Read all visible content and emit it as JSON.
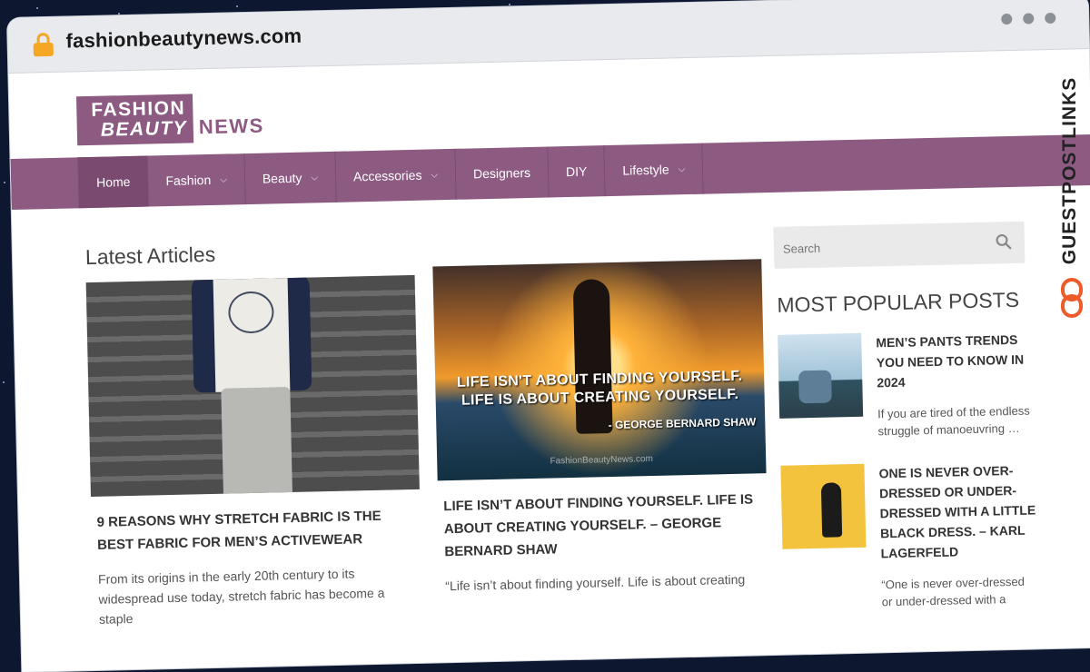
{
  "browser": {
    "url": "fashionbeautynews.com"
  },
  "logo": {
    "line1": "FASHION",
    "line2": "BEAUTY",
    "line3": "NEWS"
  },
  "nav": {
    "items": [
      {
        "label": "Home",
        "active": true
      },
      {
        "label": "Fashion",
        "dropdown": true
      },
      {
        "label": "Beauty",
        "dropdown": true
      },
      {
        "label": "Accessories",
        "dropdown": true
      },
      {
        "label": "Designers"
      },
      {
        "label": "DIY"
      },
      {
        "label": "Lifestyle",
        "dropdown": true
      }
    ]
  },
  "main": {
    "section_title": "Latest Articles",
    "articles": [
      {
        "title": "9 REASONS WHY STRETCH FABRIC IS THE BEST FABRIC FOR MEN’S ACTIVEWEAR",
        "excerpt": "From its origins in the early 20th century to its widespread use today, stretch fabric has become a staple"
      },
      {
        "title": "LIFE ISN’T ABOUT FINDING YOURSELF. LIFE IS ABOUT CREATING YOURSELF. – GEORGE BERNARD SHAW",
        "excerpt": "“Life isn’t about finding yourself. Life is about creating",
        "image_quote_line1": "LIFE ISN'T ABOUT FINDING YOURSELF.",
        "image_quote_line2": "LIFE IS ABOUT CREATING YOURSELF.",
        "image_quote_author": "- GEORGE BERNARD SHAW",
        "image_watermark": "FashionBeautyNews.com"
      }
    ]
  },
  "sidebar": {
    "search_placeholder": "Search",
    "popular_title": "MOST POPULAR POSTS",
    "posts": [
      {
        "title": "MEN’S PANTS TRENDS YOU NEED TO KNOW IN 2024",
        "excerpt": "If you are tired of the endless struggle of manoeuvring …"
      },
      {
        "title": "ONE IS NEVER OVER-DRESSED OR UNDER-DRESSED WITH A LITTLE BLACK DRESS. – KARL LAGERFELD",
        "excerpt": "“One is never over-dressed or under-dressed with a"
      }
    ]
  },
  "side_brand": "GUESTPOSTLINKS",
  "colors": {
    "brand": "#8d5b82",
    "lock": "#f5a623",
    "side_brand_icon": "#ef5a2a"
  }
}
